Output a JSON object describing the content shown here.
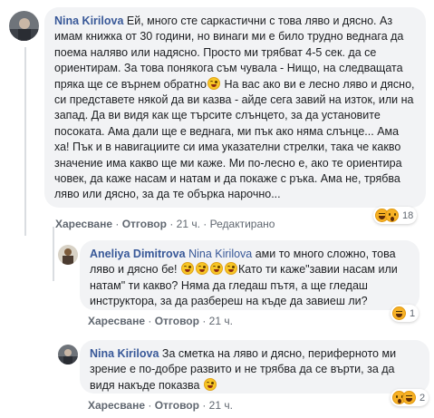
{
  "comments": [
    {
      "author": "Nina Kirilova",
      "text_1": "Ей, много сте саркастични с това ляво и дясно. Аз имам книжка от 30 години, но винаги ми е било трудно веднага да поема наляво или надясно. Просто ми трябват 4-5 сек. да се ориентирам. За това понякога съм чувала - Нищо, на следващата пряка ще се върнем обратно",
      "text_2": " На вас ако ви е лесно ляво и дясно, си представете някой да ви казва - айде сега завий на изток, или на запад. Да ви видя как ще търсите слънцето, за да установите посоката. Ама дали ще е веднага, ми пък ако няма слънце... Ама ха! Пък и в навигациите си има указателни стрелки, така че какво значение има какво ще ми каже. Ми по-лесно е, ако те ориентира човек, да каже насам и натам и да покаже с ръка. Ама не, трябва ляво или дясно, за да те обърка нарочно...",
      "like": "Харесване",
      "reply": "Отговор",
      "time": "21 ч.",
      "edited": "Редактирано",
      "reactions_count": "18",
      "reactions": [
        "laugh-emoji",
        "wow-emoji"
      ]
    },
    {
      "author": "Aneliya Dimitrova",
      "mention": "Nina Kirilova",
      "text_1": " ами то много сложно, това ляво и дясно бе! ",
      "text_2": "Като ти каже\"завии насам или натам\" ти какво? Няма да гледаш пътя, а ще гледаш инструктора, за да разбереш на къде да завиеш ли?",
      "like": "Харесване",
      "reply": "Отговор",
      "time": "21 ч.",
      "reactions_count": "1",
      "reactions": [
        "laugh-emoji"
      ]
    },
    {
      "author": "Nina Kirilova",
      "text_1": "За сметка на ляво и дясно, периферното ми зрение е по-добре развито и не трябва да се върти, за да видя накъде показва ",
      "like": "Харесване",
      "reply": "Отговор",
      "time": "21 ч.",
      "reactions_count": "2",
      "reactions": [
        "wow-emoji",
        "laugh-emoji"
      ]
    }
  ],
  "separator": "·"
}
